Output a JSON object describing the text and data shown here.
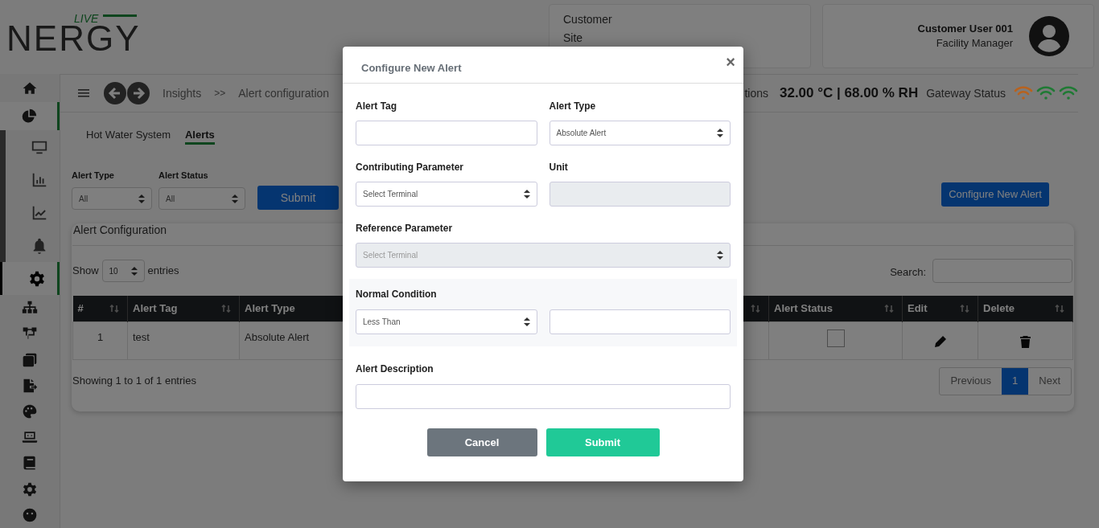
{
  "logo": {
    "tagline": "LIVE",
    "wordmark": "N**E**RGY"
  },
  "site_card": {
    "lines": [
      "Customer",
      "Site"
    ]
  },
  "user": {
    "name": "Customer User 001",
    "role": "Facility Manager"
  },
  "sidebar": {
    "items": [
      {
        "selected": false
      },
      {
        "selected": true,
        "expanded": true,
        "children": [
          {
            "selected": false
          },
          {
            "selected": false
          },
          {
            "selected": false
          },
          {
            "selected": false
          },
          {
            "selected": true
          }
        ]
      },
      {
        "selected": false
      },
      {
        "selected": false
      },
      {
        "selected": false
      },
      {
        "selected": false
      },
      {
        "selected": false
      },
      {
        "selected": false
      },
      {
        "selected": false
      },
      {
        "selected": false
      },
      {
        "selected": false
      }
    ]
  },
  "breadcrumb": [
    "Insights",
    ">>",
    "Alert configuration"
  ],
  "conditions": {
    "label": "tions",
    "reading": "32.00 °C | 68.00 % RH",
    "gateway_label": "Gateway Status",
    "gateways": [
      {
        "color": "#b8621e"
      },
      {
        "color": "#1f7a34"
      },
      {
        "color": "#1f7a34"
      }
    ]
  },
  "tabs": [
    {
      "label": "Hot Water System",
      "selected": false
    },
    {
      "label": "Alerts",
      "selected": true
    }
  ],
  "filters": [
    {
      "label": "Alert Type",
      "value": "All"
    },
    {
      "label": "Alert Status",
      "value": "All"
    }
  ],
  "filter_submit": "Submit",
  "configure_button": "Configure New Alert",
  "card": {
    "title": "Alert Configuration",
    "show_label": "Show",
    "page_size": "10",
    "entries_label": "entries",
    "search_label": "Search:",
    "columns": [
      {
        "label": "#"
      },
      {
        "label": "Alert Tag"
      },
      {
        "label": "Alert Type"
      },
      {
        "label": "Alert Status"
      },
      {
        "label": "Edit"
      },
      {
        "label": "Delete"
      }
    ],
    "rows": [
      {
        "cells": [
          {
            "kind": "number",
            "text": "1"
          },
          {
            "kind": "text",
            "text": "test"
          },
          {
            "kind": "text",
            "text": "Absolute Alert"
          },
          {
            "kind": "checkbox",
            "checked": false
          },
          {
            "kind": "edit"
          },
          {
            "kind": "delete"
          }
        ]
      }
    ],
    "info": "Showing 1 to 1 of 1 entries",
    "pages": [
      {
        "label": "Previous",
        "selected": false
      },
      {
        "label": "1",
        "selected": true
      },
      {
        "label": "Next",
        "selected": false
      }
    ]
  },
  "modal": {
    "title": "Configure New Alert",
    "close": "×",
    "fields": [
      {
        "label": "Alert Tag",
        "kind": "input",
        "disabled": false
      },
      {
        "label": "Alert Type",
        "kind": "select",
        "value": "Absolute Alert",
        "disabled": false
      },
      {
        "label": "Contributing Parameter",
        "kind": "select",
        "value": "Select Terminal",
        "disabled": false
      },
      {
        "label": "Unit",
        "kind": "input",
        "disabled": true
      },
      {
        "label": "Reference Parameter",
        "kind": "select",
        "value": "Select Terminal",
        "disabled": true
      }
    ],
    "normal_condition": {
      "label": "Normal Condition",
      "operator": "Less Than"
    },
    "description": {
      "label": "Alert Description"
    },
    "buttons": [
      {
        "label": "Cancel",
        "kind": "secondary"
      },
      {
        "label": "Submit",
        "kind": "primary"
      }
    ]
  }
}
